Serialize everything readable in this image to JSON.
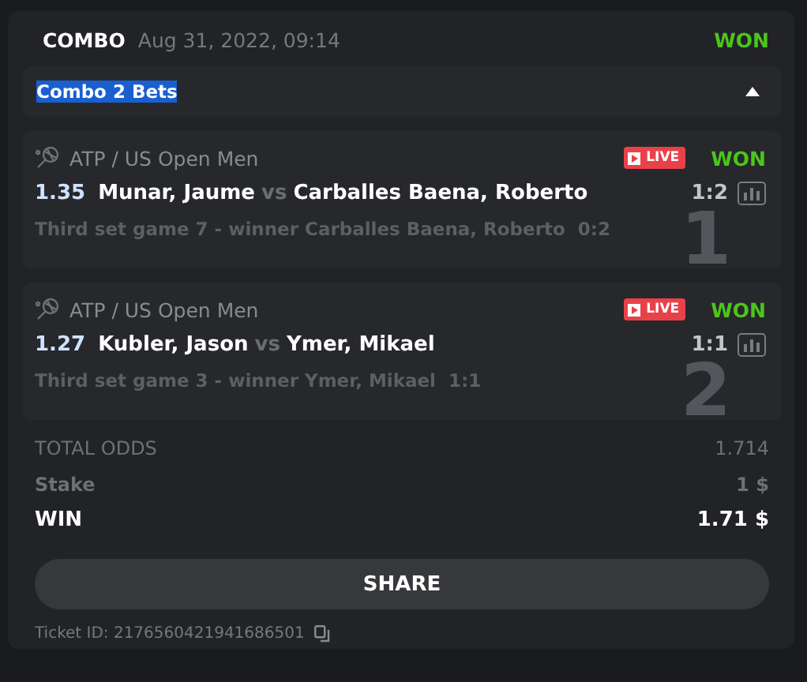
{
  "header": {
    "type": "COMBO",
    "date": "Aug 31, 2022, 09:14",
    "result": "WON"
  },
  "group": {
    "title": "Combo 2 Bets",
    "highlighted": true,
    "expanded": true
  },
  "bets": [
    {
      "league": "ATP / US Open Men",
      "live": true,
      "live_label": "LIVE",
      "result": "WON",
      "odds": "1.35",
      "home": "Munar, Jaume",
      "vs": "vs",
      "away": "Carballes Baena, Roberto",
      "score": "1:2",
      "market": "Third set game 7 - winner Carballes Baena, Roberto",
      "market_score": "0:2",
      "number": "1"
    },
    {
      "league": "ATP / US Open Men",
      "live": true,
      "live_label": "LIVE",
      "result": "WON",
      "odds": "1.27",
      "home": "Kubler, Jason",
      "vs": "vs",
      "away": "Ymer, Mikael",
      "score": "1:1",
      "market": "Third set game 3 - winner Ymer, Mikael",
      "market_score": "1:1",
      "number": "2"
    }
  ],
  "totals": [
    {
      "kind": "muted",
      "label": "TOTAL ODDS",
      "value": "1.714"
    },
    {
      "kind": "bold",
      "label": "Stake",
      "value": "1 $"
    },
    {
      "kind": "strong",
      "label": "WIN",
      "value": "1.71 $"
    }
  ],
  "share_button": "SHARE",
  "ticket_id": "Ticket ID: 2176560421941686501"
}
